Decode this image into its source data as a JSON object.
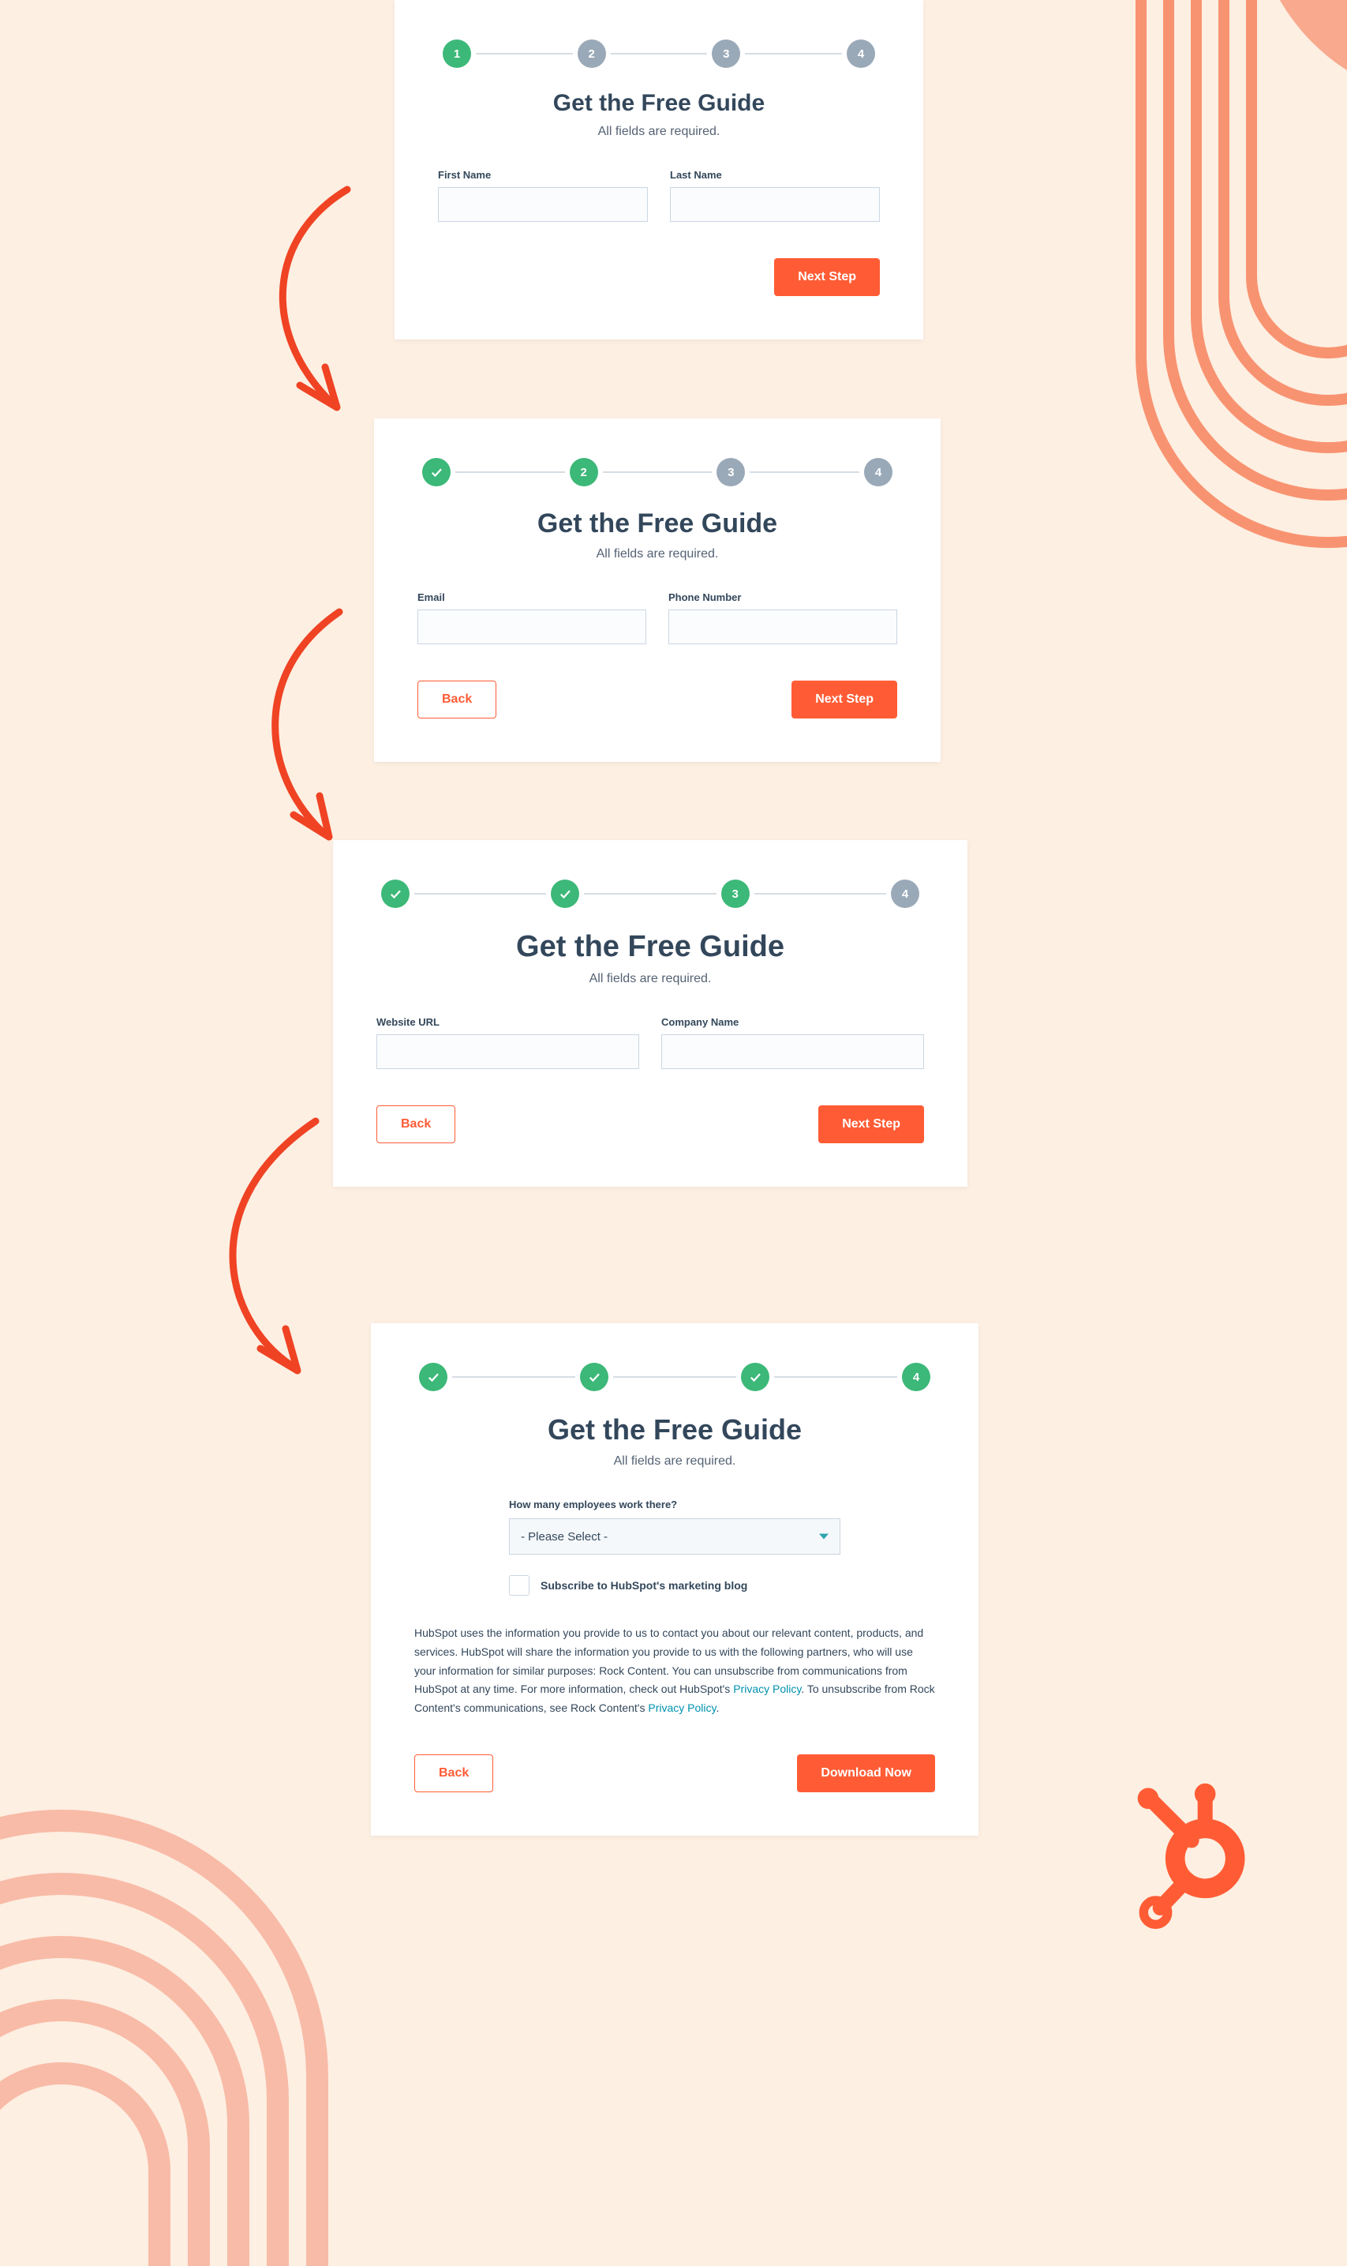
{
  "common": {
    "title": "Get the Free Guide",
    "sub": "All fields are required.",
    "next": "Next Step",
    "back": "Back",
    "download": "Download Now"
  },
  "step1": {
    "num1": "1",
    "num2": "2",
    "num3": "3",
    "num4": "4",
    "f1": "First Name",
    "f2": "Last Name"
  },
  "step2": {
    "num2": "2",
    "num3": "3",
    "num4": "4",
    "f1": "Email",
    "f2": "Phone Number"
  },
  "step3": {
    "num3": "3",
    "num4": "4",
    "f1": "Website URL",
    "f2": "Company Name"
  },
  "step4": {
    "num4": "4",
    "q": "How many employees work there?",
    "placeholder": "- Please Select -",
    "subscribe": "Subscribe to HubSpot's marketing blog",
    "consent_a": "HubSpot uses the information you provide to us to contact you about our relevant content, products, and services. HubSpot will share the information you provide to us with the following partners, who will use your information for similar purposes: Rock Content. You can unsubscribe from communications from HubSpot at any time. For more information, check out HubSpot's ",
    "pp": "Privacy Policy",
    "consent_b": ". To unsubscribe from Rock Content's communications, see Rock Content's ",
    "consent_c": "."
  }
}
